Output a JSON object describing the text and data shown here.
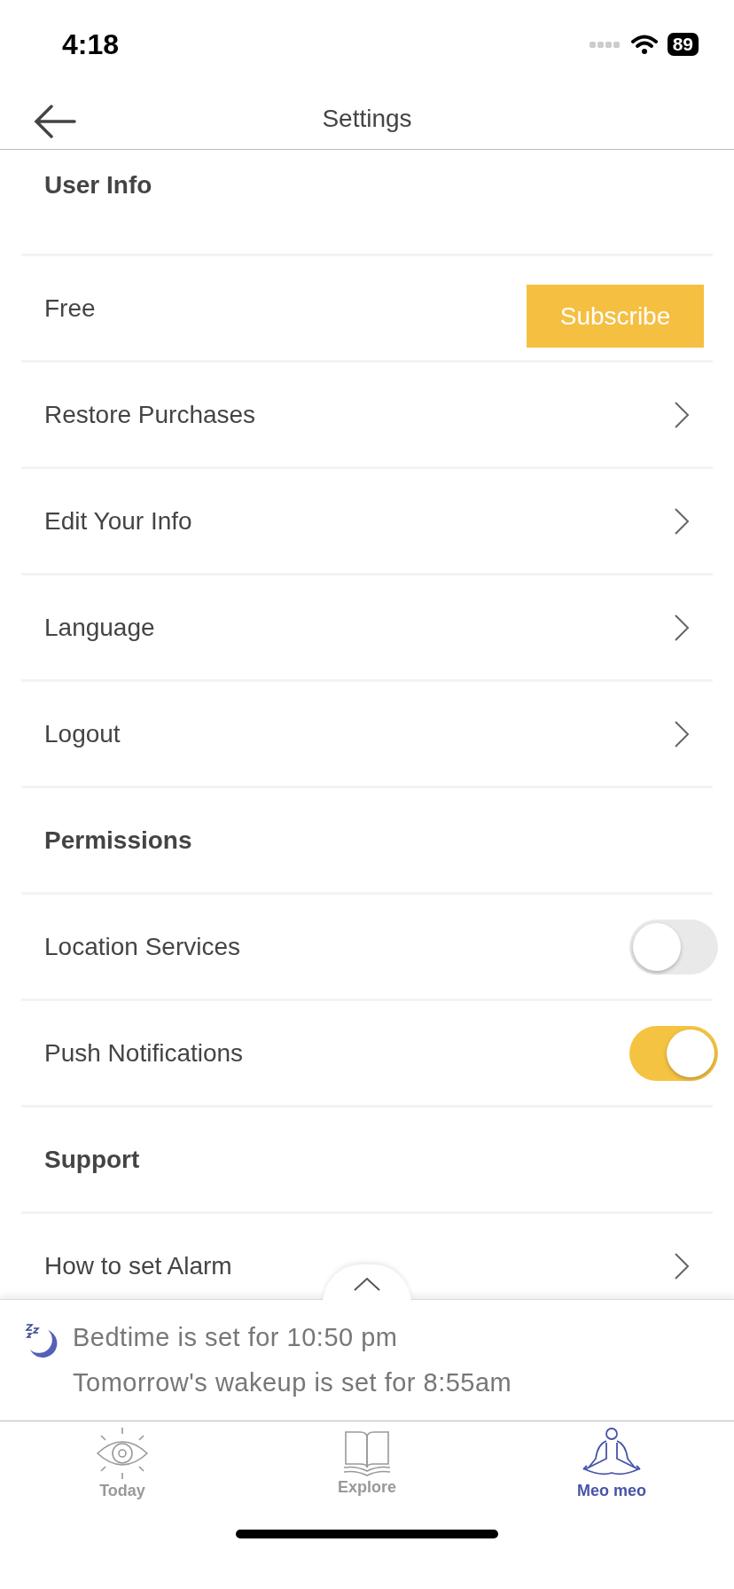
{
  "status_bar": {
    "time": "4:18",
    "battery": "89"
  },
  "nav": {
    "title": "Settings"
  },
  "rows": [
    {
      "kind": "header",
      "label": "User Info"
    },
    {
      "kind": "plan",
      "label": "Free",
      "button": "Subscribe"
    },
    {
      "kind": "link",
      "label": "Restore Purchases"
    },
    {
      "kind": "link",
      "label": "Edit Your Info"
    },
    {
      "kind": "link",
      "label": "Language"
    },
    {
      "kind": "link",
      "label": "Logout"
    },
    {
      "kind": "header",
      "label": "Permissions"
    },
    {
      "kind": "toggle",
      "label": "Location Services",
      "on": false
    },
    {
      "kind": "toggle",
      "label": "Push Notifications",
      "on": true
    },
    {
      "kind": "header",
      "label": "Support"
    },
    {
      "kind": "link",
      "label": "How to set Alarm"
    }
  ],
  "sleep_banner": {
    "bedtime": "Bedtime is set for 10:50 pm",
    "wakeup": "Tomorrow's wakeup is set for 8:55am"
  },
  "tabs": [
    {
      "label": "Today",
      "selected": false
    },
    {
      "label": "Explore",
      "selected": false
    },
    {
      "label": "Meo meo",
      "selected": true
    }
  ]
}
